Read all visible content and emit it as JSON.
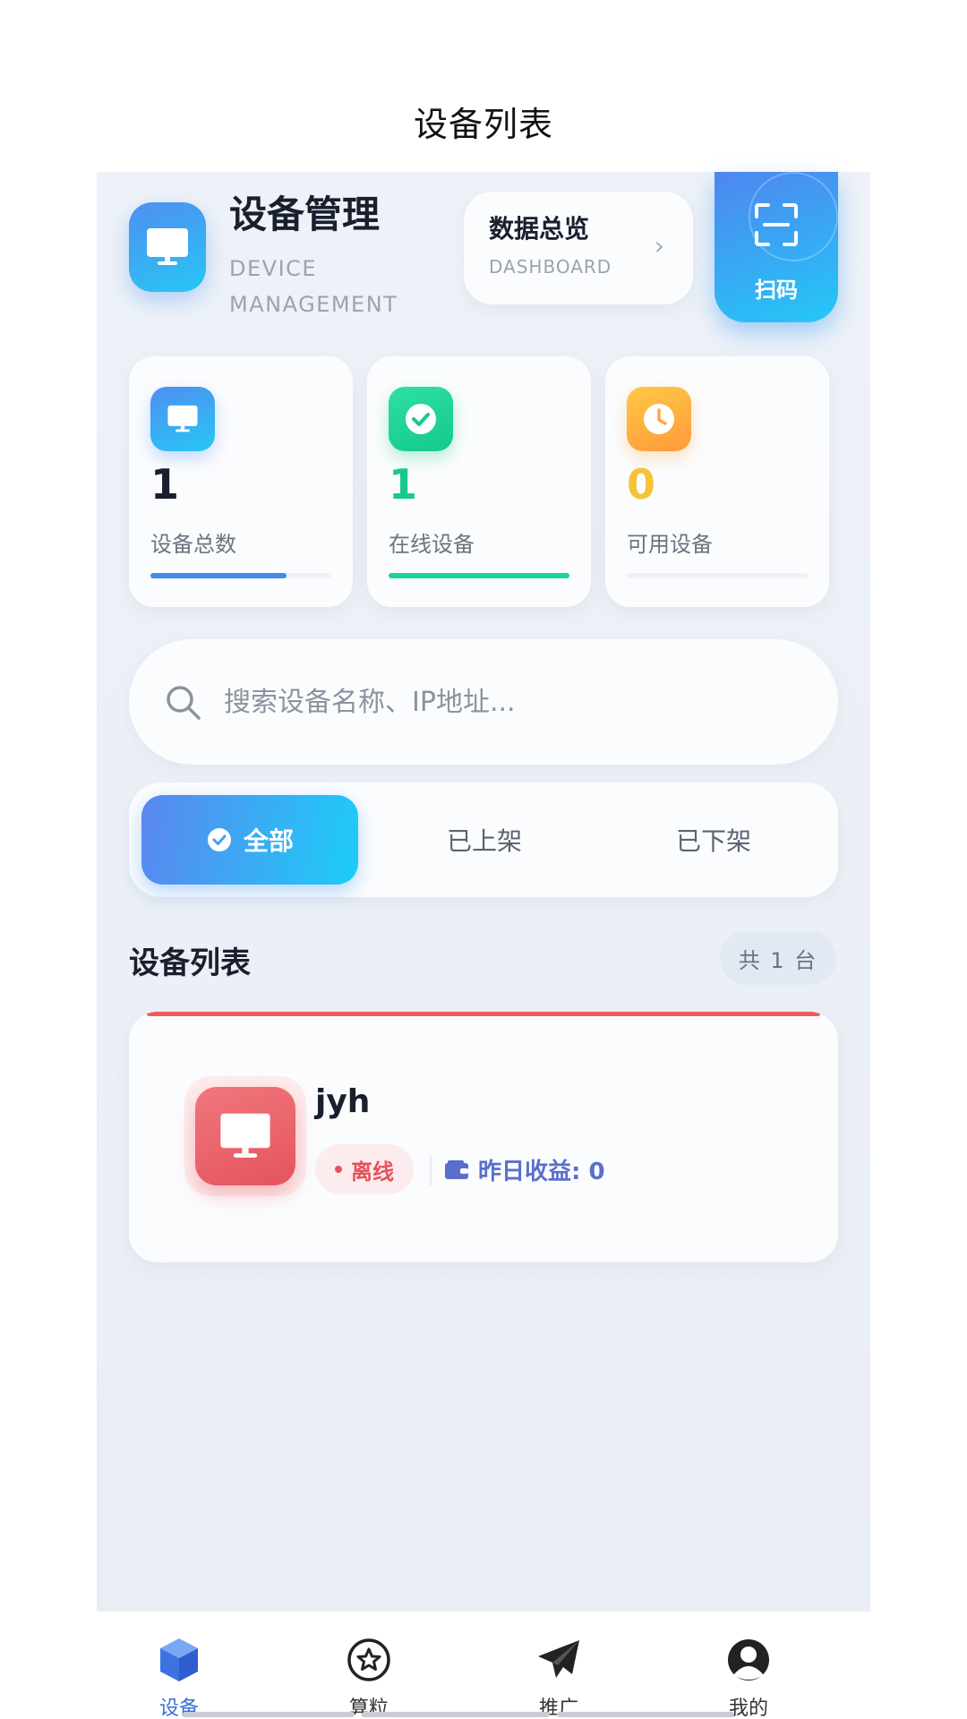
{
  "page": {
    "title": "设备列表"
  },
  "header": {
    "title": "设备管理",
    "subtitle": "DEVICE MANAGEMENT",
    "dashboard_title": "数据总览",
    "dashboard_sub": "DASHBOARD",
    "scan_label": "扫码"
  },
  "stats": [
    {
      "value": "1",
      "label": "设备总数",
      "color": "#1a1f2e",
      "progress": 0.75,
      "bar_color": "#3f8cf0"
    },
    {
      "value": "1",
      "label": "在线设备",
      "color": "#19c98a",
      "progress": 1.0,
      "bar_color": "#19d39a"
    },
    {
      "value": "0",
      "label": "可用设备",
      "color": "#f6c23a",
      "progress": 0.0,
      "bar_color": "#f6b93a"
    }
  ],
  "search": {
    "placeholder": "搜索设备名称、IP地址..."
  },
  "tabs": [
    {
      "label": "全部",
      "active": true
    },
    {
      "label": "已上架",
      "active": false
    },
    {
      "label": "已下架",
      "active": false
    }
  ],
  "list": {
    "title": "设备列表",
    "count_label": "共 1 台",
    "devices": [
      {
        "name": "jyh",
        "status": "离线",
        "earnings": "昨日收益: 0"
      }
    ]
  },
  "bottom_nav": [
    {
      "label": "设备",
      "icon": "cube-icon",
      "active": true
    },
    {
      "label": "算粒",
      "icon": "star-circle-icon",
      "active": false
    },
    {
      "label": "推广",
      "icon": "paper-plane-icon",
      "active": false
    },
    {
      "label": "我的",
      "icon": "user-icon",
      "active": false
    }
  ]
}
